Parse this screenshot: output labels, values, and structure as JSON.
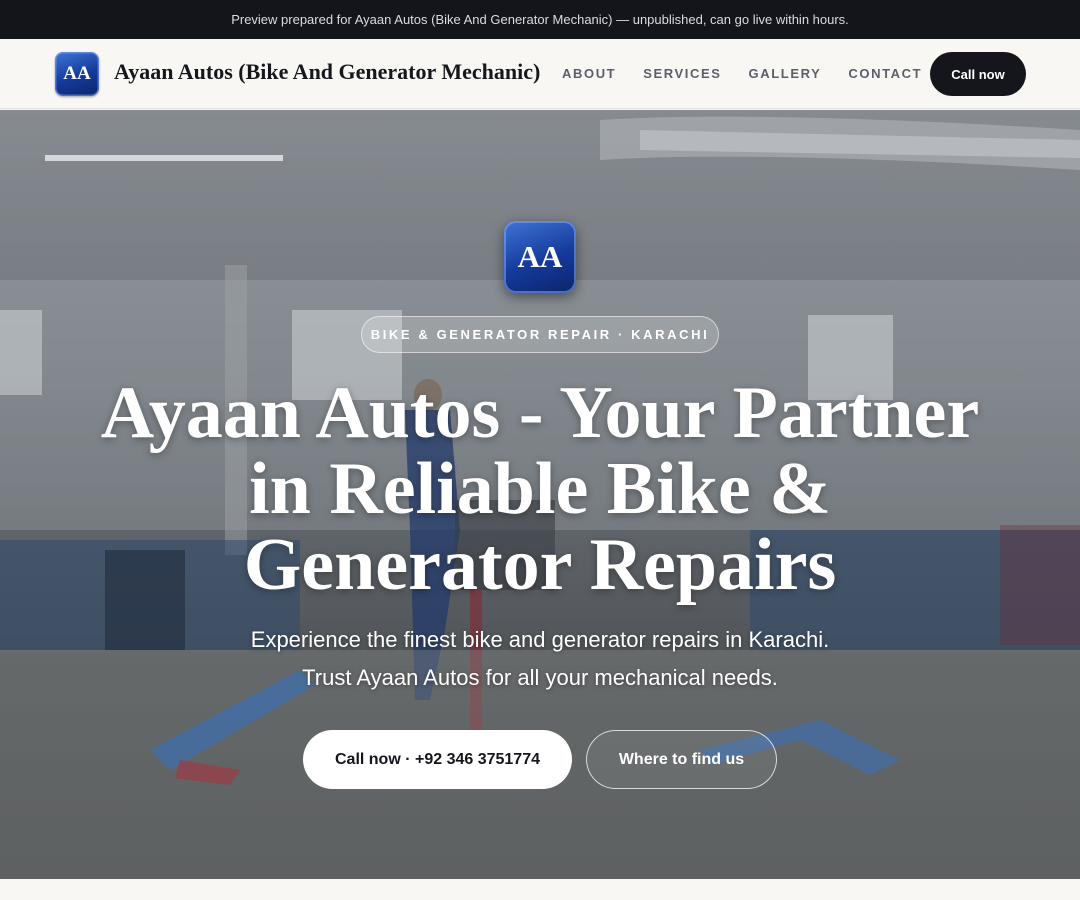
{
  "preview_bar": {
    "text": "Preview prepared for Ayaan Autos (Bike And Generator Mechanic) — unpublished, can go live within hours."
  },
  "header": {
    "logo_initials": "AA",
    "brand_name": "Ayaan Autos (Bike And Generator Mechanic)",
    "nav": [
      "ABOUT",
      "SERVICES",
      "GALLERY",
      "CONTACT"
    ],
    "cta_label": "Call now"
  },
  "hero": {
    "logo_initials": "AA",
    "eyebrow": "BIKE & GENERATOR REPAIR · KARACHI",
    "headline": "Ayaan Autos - Your Partner in Reliable Bike & Generator Repairs",
    "sub_line_1": "Experience the finest bike and generator repairs in Karachi.",
    "sub_line_2": "Trust Ayaan Autos for all your mechanical needs.",
    "primary_button": "Call now · +92 346 3751774",
    "secondary_button": "Where to find us",
    "background_image": "mechanic workshop with blue lifts"
  },
  "colors": {
    "dark": "#14161b",
    "brand_blue": "#143a9a",
    "page_bg": "#f8f7f4"
  }
}
